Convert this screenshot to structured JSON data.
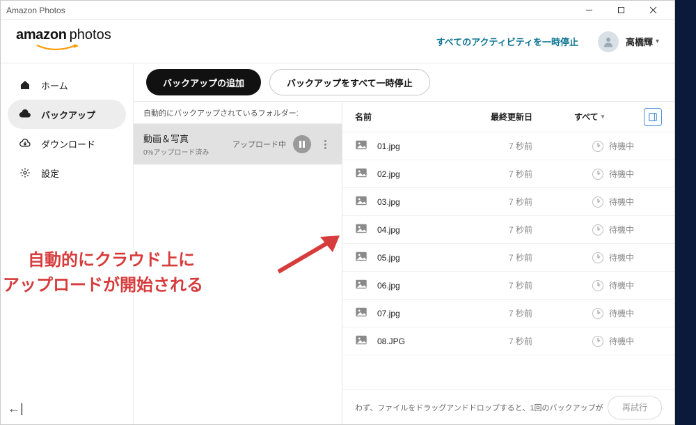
{
  "titlebar": {
    "title": "Amazon Photos"
  },
  "brand": {
    "word1": "amazon",
    "word2": "photos"
  },
  "header": {
    "pause_all": "すべてのアクティビティを一時停止",
    "username": "高橋輝"
  },
  "sidebar": {
    "items": [
      {
        "label": "ホーム"
      },
      {
        "label": "バックアップ"
      },
      {
        "label": "ダウンロード"
      },
      {
        "label": "設定"
      }
    ]
  },
  "actions": {
    "add_backup": "バックアップの追加",
    "pause_all_backups": "バックアップをすべて一時停止"
  },
  "folder_panel": {
    "header": "自動的にバックアップされているフォルダー:",
    "folder_name": "動画＆写真",
    "folder_sub": "0%アップロード済み",
    "status": "アップロード中"
  },
  "list": {
    "header_name": "名前",
    "header_date": "最終更新日",
    "header_status": "すべて",
    "rows": [
      {
        "name": "01.jpg",
        "date": "7 秒前",
        "status": "待機中"
      },
      {
        "name": "02.jpg",
        "date": "7 秒前",
        "status": "待機中"
      },
      {
        "name": "03.jpg",
        "date": "7 秒前",
        "status": "待機中"
      },
      {
        "name": "04.jpg",
        "date": "7 秒前",
        "status": "待機中"
      },
      {
        "name": "05.jpg",
        "date": "7 秒前",
        "status": "待機中"
      },
      {
        "name": "06.jpg",
        "date": "7 秒前",
        "status": "待機中"
      },
      {
        "name": "07.jpg",
        "date": "7 秒前",
        "status": "待機中"
      },
      {
        "name": "08.JPG",
        "date": "7 秒前",
        "status": "待機中"
      }
    ]
  },
  "footer": {
    "hint": "わず、ファイルをドラッグアンドドロップすると、1回のバックアップが",
    "retry": "再試行"
  },
  "annotation": {
    "line1": "自動的にクラウド上に",
    "line2": "アップロードが開始される"
  }
}
